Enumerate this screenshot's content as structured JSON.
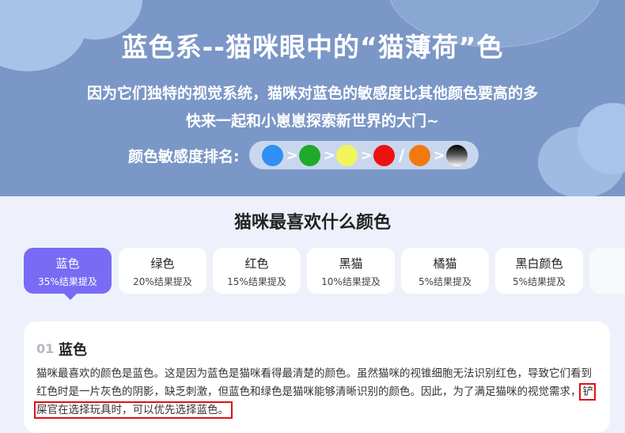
{
  "hero": {
    "title": "蓝色系--猫咪眼中的“猫薄荷”色",
    "subtitle_line1": "因为它们独特的视觉系统，猫咪对蓝色的敏感度比其他颜色要高的多",
    "subtitle_line2": "快来一起和小崽崽探索新世界的大门~",
    "rank_label": "颜色敏感度排名:",
    "rank": [
      {
        "color": "#2f8ff5",
        "sep": ">"
      },
      {
        "color": "#1faa2a",
        "sep": ">"
      },
      {
        "color": "#f2f55a",
        "sep": ">"
      },
      {
        "color": "#ee1111",
        "sep": "/"
      },
      {
        "color": "#f07a10",
        "sep": ">"
      },
      {
        "color": "gradient-black-white",
        "sep": ""
      }
    ]
  },
  "section": {
    "title": "猫咪最喜欢什么颜色",
    "tabs": [
      {
        "name": "蓝色",
        "pct": "35%结果提及",
        "active": true
      },
      {
        "name": "绿色",
        "pct": "20%结果提及",
        "active": false
      },
      {
        "name": "红色",
        "pct": "15%结果提及",
        "active": false
      },
      {
        "name": "黑猫",
        "pct": "10%结果提及",
        "active": false
      },
      {
        "name": "橘猫",
        "pct": "5%结果提及",
        "active": false
      },
      {
        "name": "黑白颜色",
        "pct": "5%结果提及",
        "active": false
      }
    ]
  },
  "card": {
    "number": "01",
    "title": "蓝色",
    "body_before": "猫咪最喜欢的颜色是蓝色。这是因为蓝色是猫咪看得最清楚的颜色。虽然猫咪的视锥细胞无法识别红色，导致它们看到红色时是一片灰色的阴影，缺乏刺激，但蓝色和绿色是猫咪能够清晰识别的颜色。因此，为了满足猫咪的视觉需求，",
    "body_highlight": "铲屎官在选择玩具时，可以优先选择蓝色。"
  },
  "colors": {
    "hero_bg": "#7b97c7",
    "accent": "#7a6bf5",
    "highlight_border": "#e01010"
  }
}
